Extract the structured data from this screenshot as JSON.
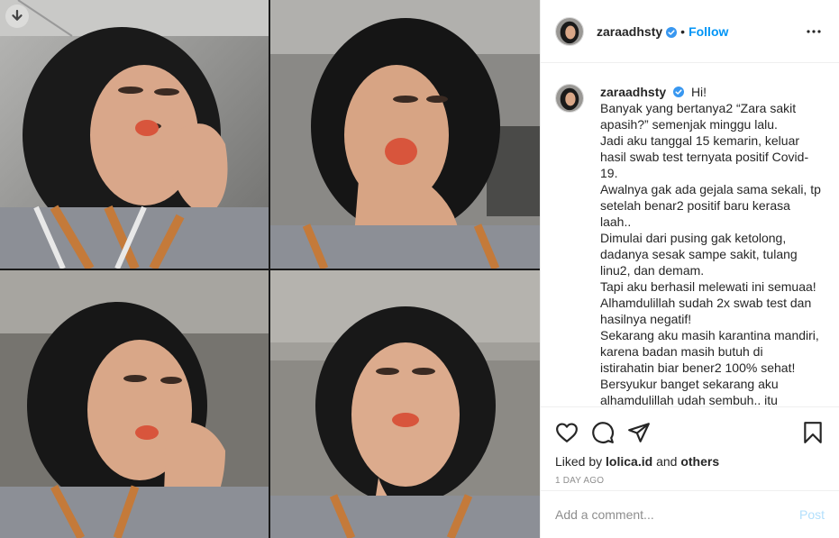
{
  "header": {
    "username": "zaraadhsty",
    "separator": "•",
    "follow_label": "Follow"
  },
  "caption": {
    "username": "zaraadhsty",
    "lines": [
      "Hi!",
      "Banyak yang bertanya2 “Zara sakit",
      "apasih?” semenjak minggu lalu.",
      "Jadi aku tanggal 15 kemarin, keluar",
      "hasil swab test ternyata positif Covid-",
      "19.",
      "Awalnya gak ada gejala sama sekali, tp",
      "setelah benar2 positif baru kerasa",
      "laah..",
      "Dimulai dari pusing gak ketolong,",
      "dadanya sesak sampe sakit, tulang",
      "linu2, dan demam.",
      "Tapi aku berhasil melewati ini semuaa!",
      "Alhamdulillah sudah 2x swab test dan",
      "hasilnya negatif!",
      "Sekarang aku masih karantina mandiri,",
      "karena badan masih butuh di",
      "istirahatin biar bener2 100% sehat!",
      "Bersyukur banget sekarang aku",
      "alhamdulillah udah sembuh.. itu"
    ]
  },
  "likes": {
    "prefix": "Liked by",
    "user": "lolica.id",
    "conjunction": "and",
    "others": "others"
  },
  "time_ago": "1 DAY AGO",
  "comment": {
    "placeholder": "Add a comment...",
    "value": "",
    "post_label": "Post"
  },
  "colors": {
    "accent": "#0095f6",
    "post_disabled": "#b2dffc",
    "muted": "#8e8e8e",
    "lip": "#d8553c"
  },
  "icons": [
    "download-icon",
    "verified-badge-icon",
    "more-options-icon",
    "heart-icon",
    "comment-icon",
    "share-icon",
    "bookmark-icon"
  ]
}
